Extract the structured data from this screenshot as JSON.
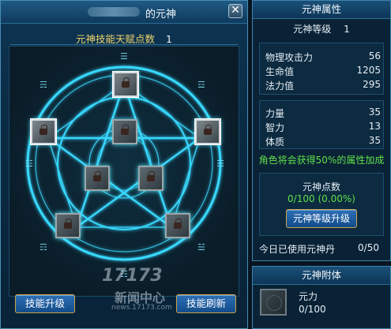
{
  "window": {
    "title": "的元神",
    "close_glyph": "✕"
  },
  "talent": {
    "label": "元神技能天赋点数",
    "value": "1"
  },
  "left_buttons": {
    "upgrade_skill": "技能升级",
    "refresh_skill": "技能刷新"
  },
  "watermark": {
    "logo": "17173",
    "sub": "新闻中心",
    "url": "news.17173.com"
  },
  "attributes": {
    "header": "元神属性",
    "level_label": "元神等级",
    "level_value": "1",
    "combat": [
      {
        "label": "物理攻击力",
        "value": "56"
      },
      {
        "label": "生命值",
        "value": "1205"
      },
      {
        "label": "法力值",
        "value": "295"
      }
    ],
    "base": [
      {
        "label": "力量",
        "value": "35"
      },
      {
        "label": "智力",
        "value": "13"
      },
      {
        "label": "体质",
        "value": "35"
      }
    ],
    "bonus_note": "角色将会获得50%的属性加成",
    "points_label": "元神点数",
    "points_value": "0/100  (0.00%)",
    "upgrade_button": "元神等级升级",
    "today_label": "今日已使用元神丹",
    "today_value": "0/50"
  },
  "possession": {
    "header": "元神附体",
    "name": "元力",
    "value": "0/100"
  },
  "colors": {
    "accent_gold": "#f1d36a",
    "accent_green": "#5fe04a",
    "glow_cyan": "#38d8ff"
  },
  "icons": [
    "close-icon",
    "lock-icon",
    "pentagram-circle"
  ]
}
